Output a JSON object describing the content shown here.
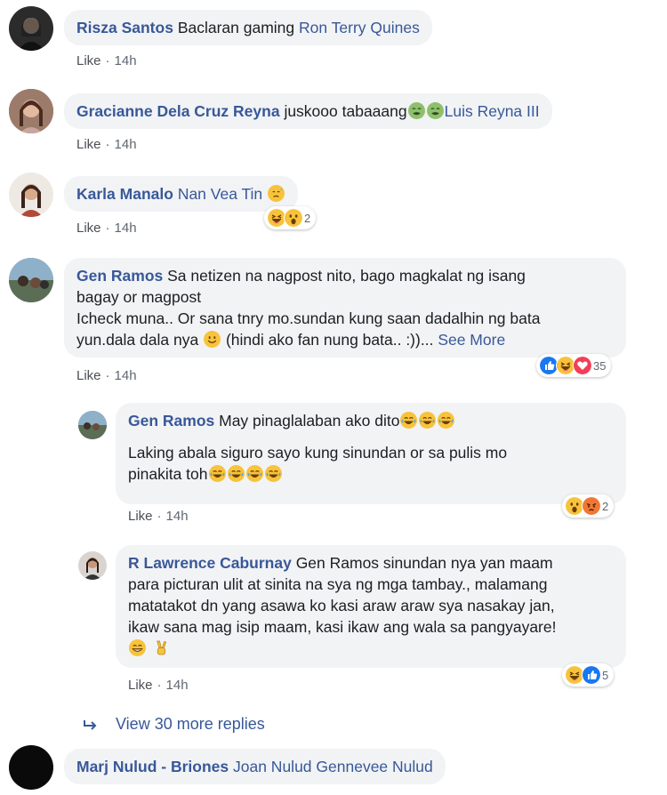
{
  "actions": {
    "like": "Like",
    "dot": "·",
    "see_more": "See More"
  },
  "comments": [
    {
      "name": "Risza Santos",
      "text": "Baclaran gaming",
      "tag": "Ron Terry Quines",
      "time": "14h"
    },
    {
      "name": "Gracianne Dela Cruz Reyna",
      "text": "juskooo tabaaang",
      "tag": "Luis Reyna III",
      "time": "14h"
    },
    {
      "name": "Karla Manalo",
      "tag": "Nan Vea Tin",
      "time": "14h",
      "reaction_count": "2"
    },
    {
      "name": "Gen Ramos",
      "line1": "Sa netizen na nagpost nito, bago magkalat ng isang",
      "line2": "bagay or magpost",
      "line3": "Icheck muna.. Or sana tnry mo.sundan kung saan dadalhin ng bata",
      "line4a": "yun.dala dala nya",
      "line4b": "(hindi ako fan nung bata.. :))...",
      "time": "14h",
      "reaction_count": "35"
    },
    {
      "name": "Marj Nulud - Briones",
      "tag": "Joan Nulud Gennevee Nulud"
    }
  ],
  "replies": [
    {
      "name": "Gen Ramos",
      "text": "May pinaglalaban ako dito",
      "line2": "Laking abala siguro sayo kung sinundan or sa pulis mo",
      "line3": "pinakita toh",
      "time": "14h",
      "reaction_count": "2"
    },
    {
      "name": "R Lawrence Caburnay",
      "line1": "Gen Ramos sinundan nya yan maam",
      "line2": "para picturan ulit at sinita na sya ng mga tambay., malamang",
      "line3": "matatakot dn yang asawa ko kasi araw araw sya nasakay jan,",
      "line4": "ikaw sana mag isip maam, kasi ikaw ang wala sa pangyayare!",
      "time": "14h",
      "reaction_count": "5"
    }
  ],
  "view_more_replies": "View 30 more replies",
  "icons": {
    "reply_arrow": "reply-arrow-icon",
    "like": "like-reaction-icon",
    "haha": "haha-reaction-icon",
    "wow": "wow-reaction-icon",
    "love": "love-reaction-icon",
    "angry": "angry-reaction-icon"
  },
  "colors": {
    "name": "#385898",
    "bubble": "#f2f3f5",
    "meta": "#606770"
  }
}
